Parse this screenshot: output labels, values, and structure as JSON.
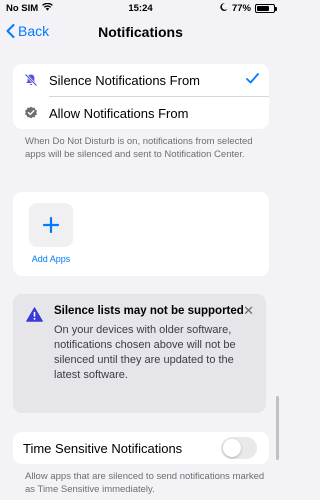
{
  "status": {
    "carrier": "No SIM",
    "time": "15:24",
    "battery": "77%",
    "battery_level": 0.77
  },
  "nav": {
    "back_label": "Back",
    "title": "Notifications"
  },
  "mode_options": {
    "silence_label": "Silence Notifications From",
    "allow_label": "Allow Notifications From",
    "selected": "silence"
  },
  "mode_footnote": "When Do Not Disturb is on, notifications from selected apps will be silenced and sent to Notification Center.",
  "add_apps": {
    "label": "Add Apps"
  },
  "warning": {
    "title": "Silence lists may not be supported",
    "body": "On your devices with older software, notifications chosen above will not be silenced until they are updated to the latest software.",
    "close": "✕"
  },
  "time_sensitive": {
    "label": "Time Sensitive Notifications",
    "enabled": false,
    "footnote": "Allow apps that are silenced to send notifications marked as Time Sensitive immediately."
  },
  "colors": {
    "accent": "#007aff",
    "warning_icon": "#3a3ad6",
    "background": "#f2f2f7"
  }
}
